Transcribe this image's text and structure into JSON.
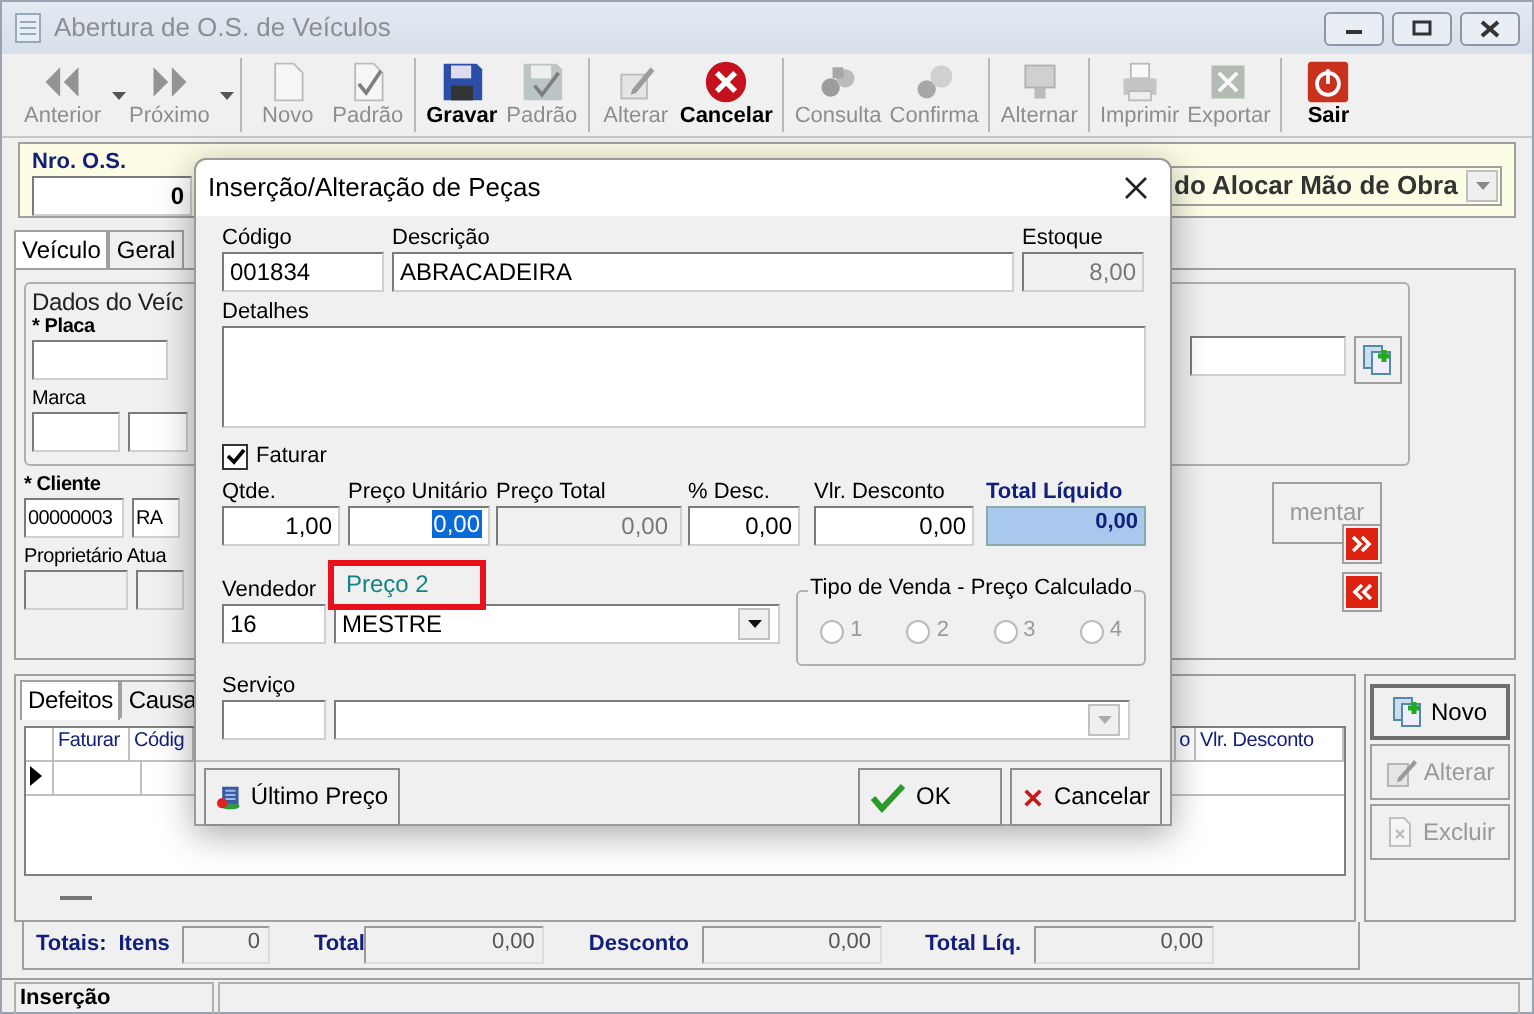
{
  "window": {
    "title": "Abertura de O.S. de Veículos"
  },
  "toolbar": [
    [
      {
        "label": "Anterior",
        "disabled": true,
        "dropdown": true
      },
      {
        "label": "Próximo",
        "disabled": true,
        "dropdown": true
      }
    ],
    [
      {
        "label": "Novo",
        "disabled": true,
        "dropdown": false
      },
      {
        "label": "Padrão",
        "disabled": true,
        "dropdown": false
      }
    ],
    [
      {
        "label": "Gravar",
        "disabled": false,
        "dropdown": false
      },
      {
        "label": "Padrão",
        "disabled": true,
        "dropdown": false
      }
    ],
    [
      {
        "label": "Alterar",
        "disabled": true,
        "dropdown": false
      },
      {
        "label": "Cancelar",
        "disabled": false,
        "dropdown": false
      }
    ],
    [
      {
        "label": "Consulta",
        "disabled": true,
        "dropdown": false
      },
      {
        "label": "Confirma",
        "disabled": true,
        "dropdown": false
      }
    ],
    [
      {
        "label": "Alternar",
        "disabled": true,
        "dropdown": false
      }
    ],
    [
      {
        "label": "Imprimir",
        "disabled": true,
        "dropdown": false
      },
      {
        "label": "Exportar",
        "disabled": true,
        "dropdown": false
      }
    ],
    [
      {
        "label": "Sair",
        "disabled": false,
        "dropdown": false
      }
    ]
  ],
  "header": {
    "os_label": "Nro. O.S.",
    "os_value": "0",
    "status_value": "do Alocar Mão de Obra"
  },
  "tabs": [
    {
      "label": "Veículo",
      "selected": true
    },
    {
      "label": "Geral",
      "selected": false
    }
  ],
  "vehicle": {
    "group_label": "Dados do Veíc",
    "plate_label": "* Placa",
    "brand_label": "Marca",
    "client_label": "* Cliente",
    "client_code": "00000003",
    "client_name": "RA",
    "owner_label": "Proprietário Atua",
    "comment_button": "mentar"
  },
  "lower_tabs": [
    {
      "label": "Defeitos",
      "selected": true
    },
    {
      "label": "Causa",
      "selected": false
    }
  ],
  "grid": {
    "columns": [
      "Faturar",
      "Códig",
      "o",
      "Vlr. Desconto"
    ]
  },
  "side_buttons": [
    {
      "label": "Novo",
      "disabled": false
    },
    {
      "label": "Alterar",
      "disabled": true
    },
    {
      "label": "Excluir",
      "disabled": true
    }
  ],
  "totals": {
    "label": "Totais:",
    "items": [
      {
        "label": "Itens",
        "value": "0"
      },
      {
        "label": "Total",
        "value": "0,00"
      },
      {
        "label": "Desconto",
        "value": "0,00"
      },
      {
        "label": "Total Líq.",
        "value": "0,00"
      }
    ]
  },
  "status_bar": {
    "text": "Inserção"
  },
  "dialog": {
    "title": "Inserção/Alteração de Peças",
    "code": {
      "label": "Código",
      "value": "001834"
    },
    "description": {
      "label": "Descrição",
      "value": "ABRACADEIRA"
    },
    "stock": {
      "label": "Estoque",
      "value": "8,00"
    },
    "details": {
      "label": "Detalhes"
    },
    "invoice": {
      "label": "Faturar",
      "checked": true
    },
    "price_fields": [
      {
        "label": "Qtde.",
        "value": "1,00",
        "kind": "input"
      },
      {
        "label": "Preço Unitário",
        "value": "0,00",
        "kind": "selected"
      },
      {
        "label": "Preço Total",
        "value": "0,00",
        "kind": "readonly"
      },
      {
        "label": "% Desc.",
        "value": "0,00",
        "kind": "input"
      },
      {
        "label": "Vlr. Desconto",
        "value": "0,00",
        "kind": "input"
      },
      {
        "label": "Total Líquido",
        "value": "0,00",
        "kind": "total"
      }
    ],
    "tooltip": {
      "text": "Preço 2",
      "highlighted": true
    },
    "seller": {
      "label": "Vendedor",
      "code": "16",
      "value": "MESTRE"
    },
    "sale_type": {
      "label": "Tipo de Venda - Preço Calculado",
      "disabled": true,
      "options": [
        {
          "label": "1",
          "selected": false
        },
        {
          "label": "2",
          "selected": false
        },
        {
          "label": "3",
          "selected": false
        },
        {
          "label": "4",
          "selected": false
        }
      ]
    },
    "service": {
      "label": "Serviço"
    },
    "buttons": [
      {
        "label": "Último Preço"
      },
      {
        "label": "OK"
      },
      {
        "label": "Cancelar"
      }
    ]
  }
}
